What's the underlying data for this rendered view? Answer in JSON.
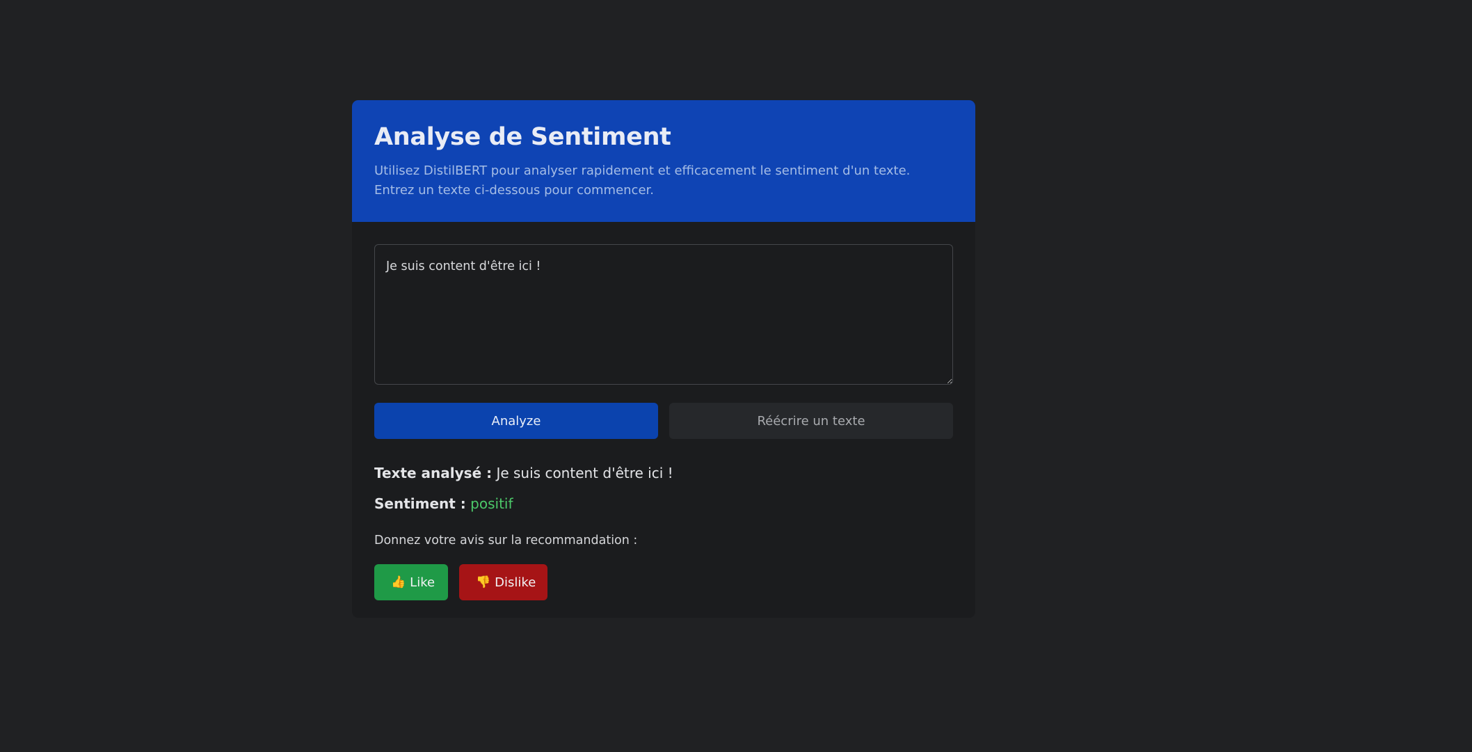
{
  "header": {
    "title": "Analyse de Sentiment",
    "subtitle": "Utilisez DistilBERT pour analyser rapidement et efficacement le sentiment d'un texte. Entrez un texte ci-dessous pour commencer."
  },
  "input": {
    "value": "Je suis content d'être ici !"
  },
  "actions": {
    "analyze_label": "Analyze",
    "rewrite_label": "Réécrire un texte"
  },
  "result": {
    "analyzed_label": "Texte analysé :",
    "analyzed_text": "Je suis content d'être ici !",
    "sentiment_label": "Sentiment :",
    "sentiment_value": "positif",
    "sentiment_color": "#4cc869"
  },
  "feedback": {
    "prompt": "Donnez votre avis sur la recommandation :",
    "like_icon": "thumbs-up-icon",
    "like_label": "Like",
    "dislike_icon": "thumbs-down-icon",
    "dislike_label": "Dislike"
  },
  "colors": {
    "page_background": "#202123",
    "header_background": "#0f44b4",
    "primary_button": "#0b43ae",
    "like_button": "#1f9a47",
    "dislike_button": "#a61416"
  }
}
